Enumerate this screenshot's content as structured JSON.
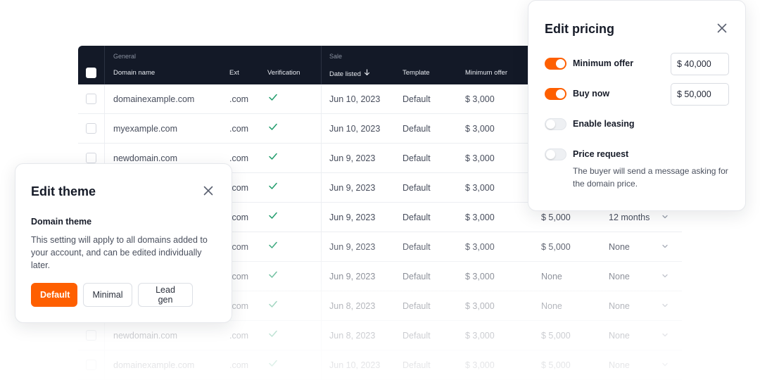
{
  "table": {
    "group_general": "General",
    "group_sale": "Sale",
    "columns": {
      "domain": "Domain name",
      "ext": "Ext",
      "verification": "Verification",
      "date": "Date listed",
      "template": "Template",
      "min_offer": "Minimum offer"
    },
    "rows": [
      {
        "domain": "domainexample.com",
        "ext": ".com",
        "date": "Jun 10, 2023",
        "template": "Default",
        "min_offer": "$ 3,000",
        "buy_now": "",
        "lease": ""
      },
      {
        "domain": "myexample.com",
        "ext": ".com",
        "date": "Jun 10, 2023",
        "template": "Default",
        "min_offer": "$ 3,000",
        "buy_now": "",
        "lease": ""
      },
      {
        "domain": "newdomain.com",
        "ext": ".com",
        "date": "Jun 9, 2023",
        "template": "Default",
        "min_offer": "$ 3,000",
        "buy_now": "",
        "lease": ""
      },
      {
        "domain": "",
        "ext": ".com",
        "date": "Jun 9, 2023",
        "template": "Default",
        "min_offer": "$ 3,000",
        "buy_now": "",
        "lease": ""
      },
      {
        "domain": "",
        "ext": ".com",
        "date": "Jun 9, 2023",
        "template": "Default",
        "min_offer": "$ 3,000",
        "buy_now": "$ 5,000",
        "lease": "12 months"
      },
      {
        "domain": "",
        "ext": ".com",
        "date": "Jun 9, 2023",
        "template": "Default",
        "min_offer": "$ 3,000",
        "buy_now": "$ 5,000",
        "lease": "None"
      },
      {
        "domain": "",
        "ext": ".com",
        "date": "Jun 9, 2023",
        "template": "Default",
        "min_offer": "$ 3,000",
        "buy_now": "None",
        "lease": "None"
      },
      {
        "domain": "",
        "ext": ".com",
        "date": "Jun 8, 2023",
        "template": "Default",
        "min_offer": "$ 3,000",
        "buy_now": "None",
        "lease": "None"
      },
      {
        "domain": "newdomain.com",
        "ext": ".com",
        "date": "Jun 8, 2023",
        "template": "Default",
        "min_offer": "$ 3,000",
        "buy_now": "$ 5,000",
        "lease": "None"
      },
      {
        "domain": "domainexample.com",
        "ext": ".com",
        "date": "Jun 10, 2023",
        "template": "Default",
        "min_offer": "$ 3,000",
        "buy_now": "$ 5,000",
        "lease": "None"
      }
    ]
  },
  "theme_card": {
    "title": "Edit theme",
    "subtitle": "Domain theme",
    "description": "This setting will apply to all domains added to your account, and can be edited individually later.",
    "buttons": [
      "Default",
      "Minimal",
      "Lead gen"
    ],
    "selected": "Default"
  },
  "pricing_card": {
    "title": "Edit pricing",
    "options": [
      {
        "label": "Minimum offer",
        "enabled": true,
        "value": "$ 40,000"
      },
      {
        "label": "Buy now",
        "enabled": true,
        "value": "$ 50,000"
      },
      {
        "label": "Enable leasing",
        "enabled": false
      },
      {
        "label": "Price request",
        "enabled": false,
        "description": "The buyer will send a message asking for the domain price."
      }
    ]
  },
  "colors": {
    "accent": "#fe5f00",
    "header_bg": "#131927",
    "check_green": "#1f9c6b"
  }
}
